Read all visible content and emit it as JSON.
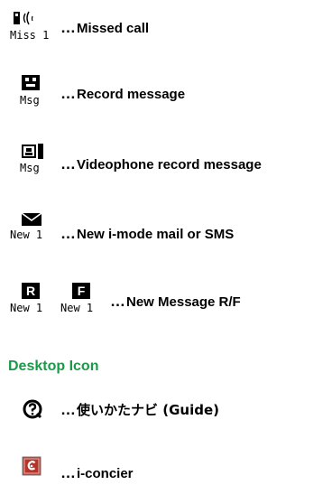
{
  "items": [
    {
      "icon": "missed-call-phone-icon",
      "sublabel": "Miss 1",
      "label": "Missed call"
    },
    {
      "icon": "record-message-icon",
      "sublabel": "Msg",
      "label": "Record message"
    },
    {
      "icon": "videophone-record-icon",
      "sublabel": "Msg",
      "label": "Videophone record message"
    },
    {
      "icon": "envelope-icon",
      "sublabel": "New 1",
      "label": "New i-mode mail or SMS"
    },
    {
      "icon": "message-rf-icon",
      "sublabel_r": "New 1",
      "sublabel_f": "New 1",
      "glyph_r": "R",
      "glyph_f": "F",
      "label": "New Message R/F"
    }
  ],
  "section": {
    "title": "Desktop Icon"
  },
  "desktop": [
    {
      "icon": "guide-icon",
      "label": "使いかたナビ (Guide)"
    },
    {
      "icon": "i-concier-icon",
      "label": "i-concier"
    }
  ],
  "dots": "…",
  "colors": {
    "section_title": "#1a9a49",
    "concier_bg": "#b4342a"
  }
}
